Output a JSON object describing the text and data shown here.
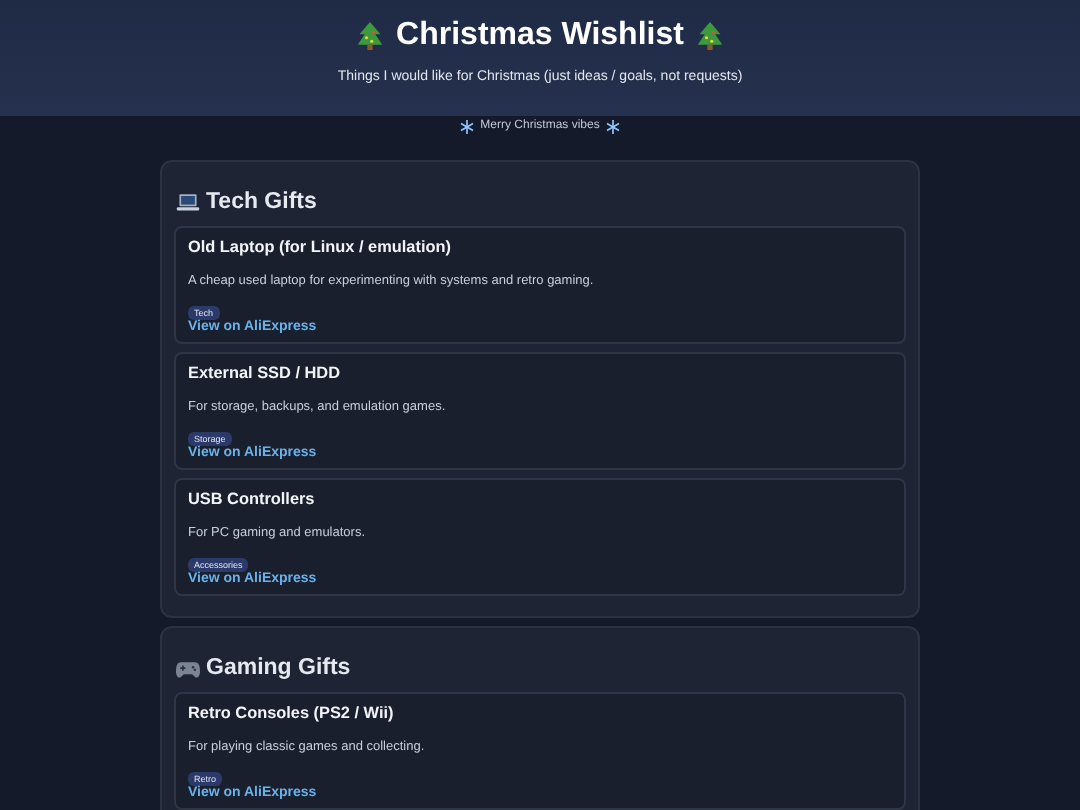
{
  "header": {
    "title": "Christmas Wishlist",
    "subtitle": "Things I would like for Christmas (just ideas / goals, not requests)"
  },
  "banner": "Merry Christmas vibes",
  "sections": [
    {
      "kind": "tech",
      "title": "Tech Gifts",
      "items": [
        {
          "name": "Old Laptop (for Linux / emulation)",
          "description": "A cheap used laptop for experimenting with systems and retro gaming.",
          "tag": "Tech",
          "link": "View on AliExpress"
        },
        {
          "name": "External SSD / HDD",
          "description": "For storage, backups, and emulation games.",
          "tag": "Storage",
          "link": "View on AliExpress"
        },
        {
          "name": "USB Controllers",
          "description": "For PC gaming and emulators.",
          "tag": "Accessories",
          "link": "View on AliExpress"
        }
      ]
    },
    {
      "kind": "gaming",
      "title": "Gaming Gifts",
      "items": [
        {
          "name": "Retro Consoles (PS2 / Wii)",
          "description": "For playing classic games and collecting.",
          "tag": "Retro",
          "link": "View on AliExpress"
        }
      ]
    }
  ]
}
